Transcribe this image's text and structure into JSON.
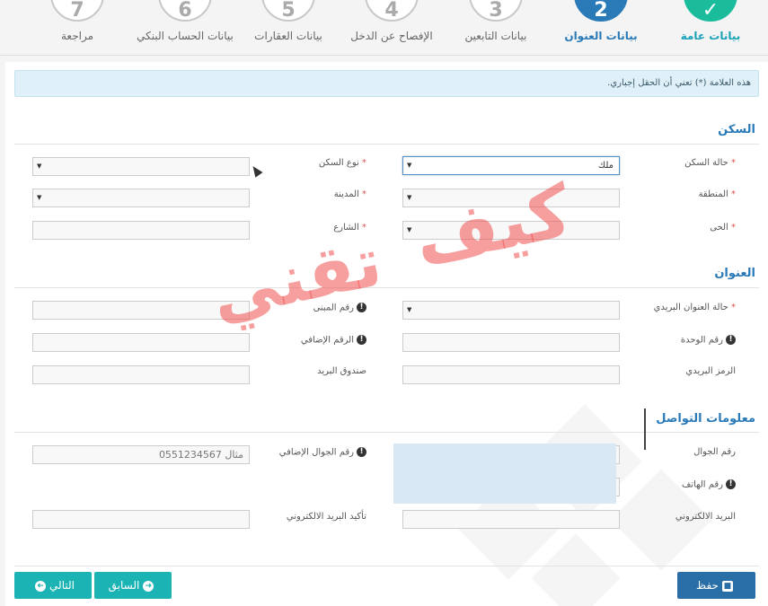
{
  "wizard": {
    "steps": [
      {
        "number": "✓",
        "label": "بيانات عامة",
        "state": "done"
      },
      {
        "number": "2",
        "label": "بيانات العنوان",
        "state": "active"
      },
      {
        "number": "3",
        "label": "بيانات التابعين",
        "state": "pending"
      },
      {
        "number": "4",
        "label": "الإفصاح عن الدخل",
        "state": "pending"
      },
      {
        "number": "5",
        "label": "بيانات العقارات",
        "state": "pending"
      },
      {
        "number": "6",
        "label": "بيانات الحساب البنكي",
        "state": "pending"
      },
      {
        "number": "7",
        "label": "مراجعة",
        "state": "pending"
      }
    ]
  },
  "info_text": "هذه العلامة (*) تعني أن الحقل إجباري.",
  "housing": {
    "title": "السكن",
    "status_label": "حالة السكن",
    "status_value": "ملك",
    "type_label": "نوع السكن",
    "region_label": "المنطقة",
    "city_label": "المدينة",
    "district_label": "الحى",
    "street_label": "الشارع"
  },
  "address": {
    "title": "العنوان",
    "postal_status_label": "حالة العنوان البريدي",
    "building_no_label": "رقم المبنى",
    "unit_no_label": "رقم الوحدة",
    "additional_no_label": "الرقم الإضافي",
    "postal_code_label": "الرمز البريدي",
    "po_box_label": "صندوق البريد"
  },
  "contact": {
    "title": "معلومات التواصل",
    "mobile_label": "رقم الجوال",
    "alt_mobile_label": "رقم الجوال الإضافي",
    "alt_mobile_placeholder": "مثال 0551234567",
    "phone_label": "رقم الهاتف",
    "email_label": "البريد الالكتروني",
    "confirm_email_label": "تأكيد البريد الالكتروني"
  },
  "watermark": {
    "line1": "كيف",
    "line2": "تقني"
  },
  "buttons": {
    "save": "حفظ",
    "previous": "السابق",
    "next": "التالي"
  },
  "required_mark": "*",
  "info_icon": "!",
  "colors": {
    "accent": "#2a7ab8",
    "done": "#1abc9c",
    "nav_button": "#1bb3b3",
    "save_button": "#2a6ea8"
  }
}
